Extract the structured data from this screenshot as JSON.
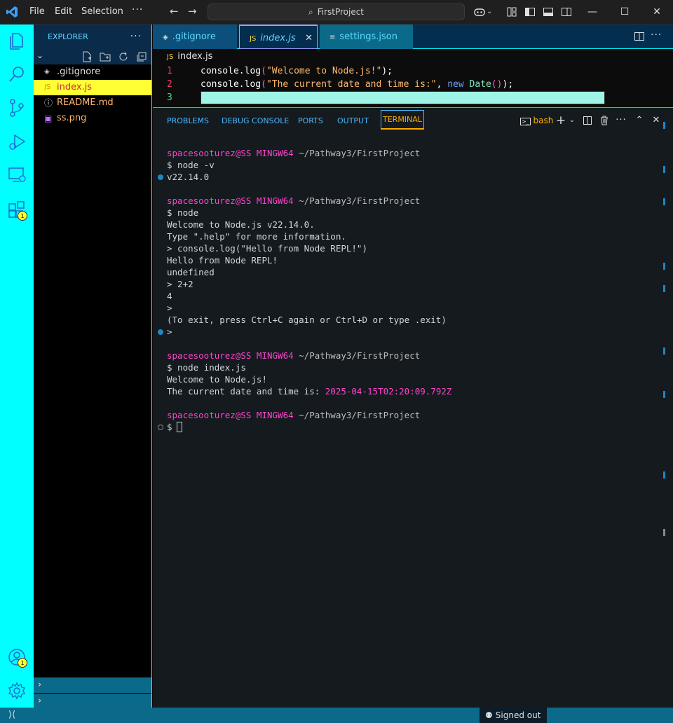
{
  "titlebar": {
    "menu": [
      "File",
      "Edit",
      "Selection"
    ],
    "more": "···",
    "search": "FirstProject",
    "icons": [
      "vscode-logo",
      "back-arrow",
      "forward-arrow",
      "search-icon",
      "copilot-icon",
      "layout-icons",
      "minimize",
      "maximize",
      "close"
    ]
  },
  "activity": {
    "items": [
      "explorer-icon",
      "search-icon",
      "source-control-icon",
      "run-debug-icon",
      "remote-explorer-icon",
      "extensions-icon",
      "accounts-icon",
      "settings-gear-icon"
    ],
    "extensions_badge": "1",
    "accounts_badge": "1"
  },
  "sidebar": {
    "title": "EXPLORER",
    "more": "···",
    "files": [
      {
        "icon": "◈",
        "name": ".gitignore",
        "color": "#e0e0e0"
      },
      {
        "icon": "JS",
        "name": "index.js",
        "color": "#c83232",
        "active": true
      },
      {
        "icon": "ⓘ",
        "name": "README.md",
        "color": "#ffb86c"
      },
      {
        "icon": "▣",
        "name": "ss.png",
        "color": "#ffb86c"
      }
    ]
  },
  "tabs": [
    {
      "icon": "◈",
      "label": ".gitignore"
    },
    {
      "icon": "JS",
      "label": "index.js",
      "close": "✕"
    },
    {
      "icon": "≡",
      "label": "settings.json"
    }
  ],
  "breadcrumb": {
    "icon": "JS",
    "label": "index.js"
  },
  "code": {
    "line_numbers": [
      "1",
      "2",
      "3"
    ],
    "line1": {
      "obj": "console",
      "dot": ".",
      "fn": "log",
      "open": "(",
      "str": "\"Welcome to Node.js!\"",
      "close": ");"
    },
    "line2": {
      "obj": "console",
      "dot": ".",
      "fn": "log",
      "open": "(",
      "str": "\"The current date and time is:\"",
      "comma": ", ",
      "kw": "new",
      "cls": "Date",
      "inner": "()",
      "close": ");"
    }
  },
  "panel": {
    "tabs": [
      "PROBLEMS",
      "DEBUG CONSOLE",
      "PORTS",
      "OUTPUT",
      "TERMINAL"
    ],
    "active_tab": "TERMINAL",
    "shell": "bash",
    "terminal": {
      "user": "spacesooturez@SS MINGW64",
      "path": "~/Pathway3/FirstProject",
      "cmd1": "$ node -v",
      "out1": "v22.14.0",
      "cmd2": "$ node",
      "repl1": "Welcome to Node.js v22.14.0.",
      "repl2": "Type \".help\" for more information.",
      "repl3": "> console.log(\"Hello from Node REPL!\")",
      "repl4": "Hello from Node REPL!",
      "repl5": "undefined",
      "repl6": "> 2+2",
      "repl7": "4",
      "repl8": ">",
      "repl9": "(To exit, press Ctrl+C again or Ctrl+D or type .exit)",
      "repl10": ">",
      "cmd3": "$ node index.js",
      "out3a": "Welcome to Node.js!",
      "out3b_label": "The current date and time is: ",
      "out3b_date": "2025-04-15T02:20:09.792Z",
      "prompt": "$"
    }
  },
  "statusbar": {
    "remote": "⟩⟨",
    "signed_out": "Signed out"
  },
  "colors": {
    "activity_bg": "#00ffff",
    "active_file_bg": "#ffff33",
    "terminal_user": "#ff44cc"
  }
}
